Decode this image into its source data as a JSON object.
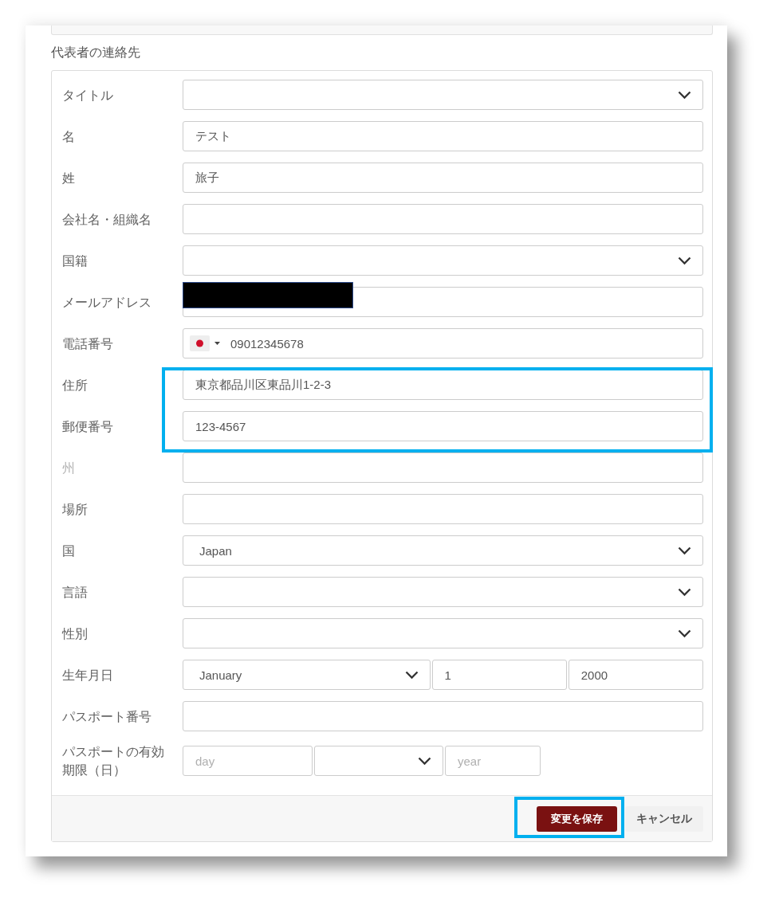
{
  "section": {
    "title": "代表者の連絡先"
  },
  "form": {
    "rows": [
      {
        "label": "タイトル",
        "kind": "select",
        "disabled": false,
        "highlighted": false
      },
      {
        "label": "名",
        "kind": "text",
        "value": "テスト",
        "disabled": false,
        "highlighted": false
      },
      {
        "label": "姓",
        "kind": "text",
        "value": "旅子",
        "disabled": false,
        "highlighted": false
      },
      {
        "label": "会社名・組織名",
        "kind": "text",
        "disabled": false,
        "highlighted": false
      },
      {
        "label": "国籍",
        "kind": "select",
        "disabled": false,
        "highlighted": false
      },
      {
        "label": "メールアドレス",
        "kind": "redacted",
        "disabled": false,
        "highlighted": false
      },
      {
        "label": "電話番号",
        "kind": "phone",
        "value": "09012345678",
        "disabled": false,
        "highlighted": false
      },
      {
        "label": "住所",
        "kind": "text",
        "value": "東京都品川区東品川1-2-3",
        "disabled": false,
        "highlighted": true
      },
      {
        "label": "郵便番号",
        "kind": "text",
        "value": "123-4567",
        "disabled": false,
        "highlighted": true
      },
      {
        "label": "州",
        "kind": "text",
        "disabled": true,
        "highlighted": false
      },
      {
        "label": "場所",
        "kind": "text",
        "disabled": false,
        "highlighted": false
      },
      {
        "label": "国",
        "kind": "select",
        "value": "Japan",
        "disabled": false,
        "highlighted": false
      },
      {
        "label": "言語",
        "kind": "select",
        "disabled": false,
        "highlighted": false
      },
      {
        "label": "性別",
        "kind": "select",
        "disabled": false,
        "highlighted": false
      },
      {
        "label": "生年月日",
        "kind": "date",
        "disabled": false,
        "highlighted": false,
        "parts": [
          {
            "kind": "select",
            "value": "January"
          },
          {
            "kind": "text",
            "value": "1"
          },
          {
            "kind": "text",
            "value": "2000"
          }
        ]
      },
      {
        "label": "パスポート番号",
        "kind": "text",
        "disabled": false,
        "highlighted": false
      },
      {
        "label": "パスポートの有効期限（日）",
        "kind": "expiry",
        "disabled": false,
        "highlighted": false,
        "parts": [
          {
            "kind": "text",
            "placeholder": "day"
          },
          {
            "kind": "select"
          },
          {
            "kind": "text",
            "placeholder": "year"
          }
        ]
      }
    ]
  },
  "footer": {
    "buttons": [
      {
        "label": "変更を保存",
        "kind": "primary",
        "highlighted": true
      },
      {
        "label": "キャンセル",
        "kind": "secondary",
        "highlighted": false
      }
    ]
  }
}
